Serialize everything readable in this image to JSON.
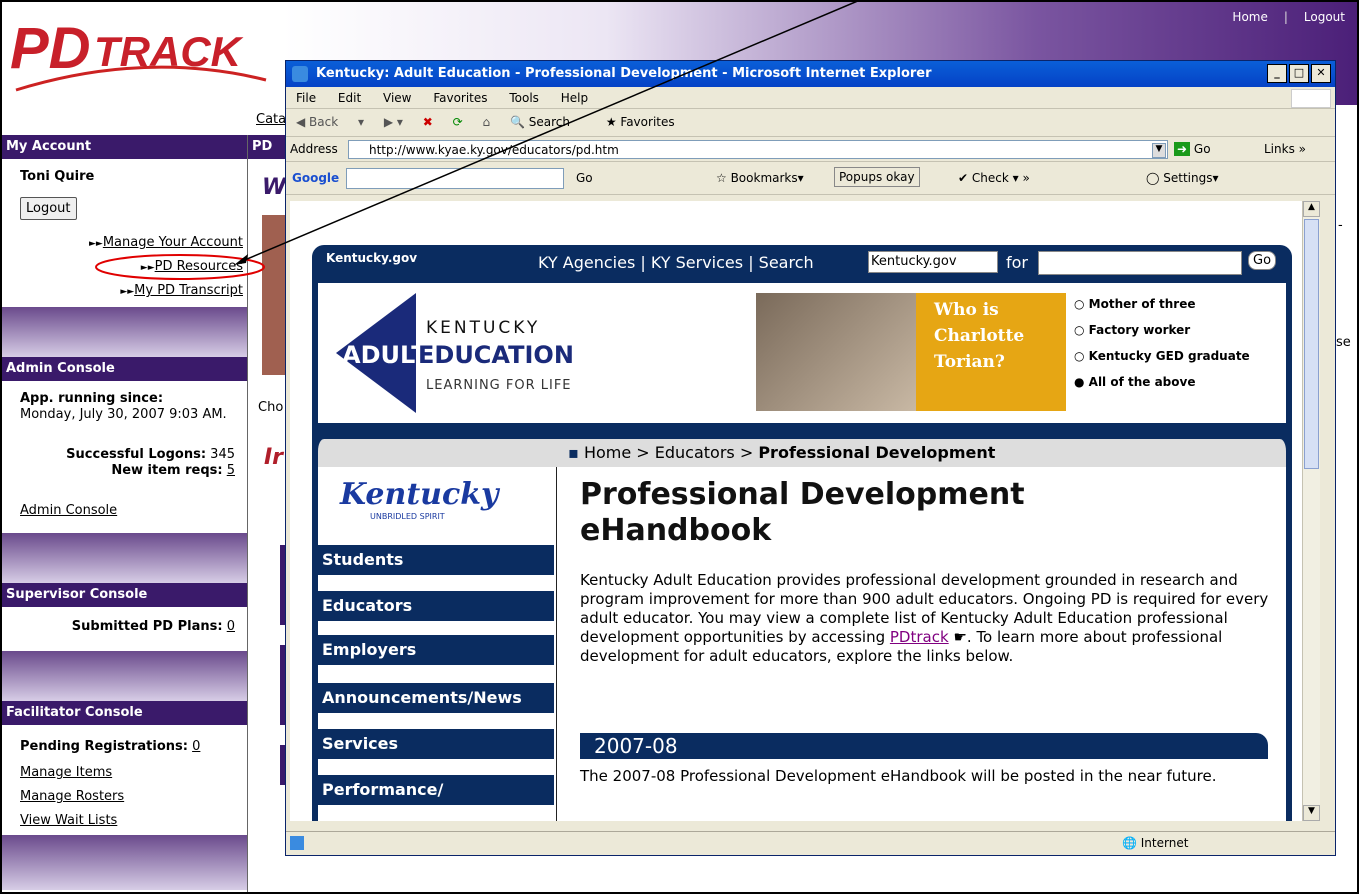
{
  "outer": {
    "toplinks": [
      "Home",
      "Logout"
    ],
    "logo": {
      "pd": "PD",
      "track": "TRACK"
    },
    "cata": "Cata",
    "pd_col": "PD",
    "w": "W",
    "cho": "Cho",
    "ir": "Ir",
    "se": "se",
    "my_account": {
      "title": "My Account",
      "user": "Toni Quire",
      "logout": "Logout",
      "links": [
        "Manage Your Account",
        "PD Resources",
        "My PD Transcript"
      ]
    },
    "admin": {
      "title": "Admin Console",
      "running_label": "App. running since:",
      "running_value": "Monday, July 30, 2007 9:03 AM.",
      "logons_label": "Successful Logons:",
      "logons_value": "345",
      "newreq_label": "New item reqs:",
      "newreq_value": "5",
      "link": "Admin Console"
    },
    "supervisor": {
      "title": "Supervisor Console",
      "plans_label": "Submitted PD Plans:",
      "plans_value": "0"
    },
    "facilitator": {
      "title": "Facilitator Console",
      "pending_label": "Pending Registrations:",
      "pending_value": "0",
      "links": [
        "Manage Items",
        "Manage Rosters",
        "View Wait Lists"
      ]
    }
  },
  "ie": {
    "title": "Kentucky: Adult Education - Professional Development - Microsoft Internet Explorer",
    "menu": [
      "File",
      "Edit",
      "View",
      "Favorites",
      "Tools",
      "Help"
    ],
    "toolbar": [
      "Back",
      "Search",
      "Favorites"
    ],
    "address_label": "Address",
    "url": "http://www.kyae.ky.gov/educators/pd.htm",
    "go": "Go",
    "links": "Links",
    "google": {
      "go": "Go",
      "bookmarks": "Bookmarks",
      "popups": "Popups okay",
      "check": "Check",
      "settings": "Settings"
    },
    "status": "Internet"
  },
  "ky": {
    "brand": "Kentucky.gov",
    "topnav": "KY Agencies | KY Services | Search",
    "search_scope": "Kentucky.gov",
    "for": "for",
    "go": "Go",
    "logo_top": "KENTUCKY",
    "logo_adult": "ADULT",
    "logo_edu": "EDUCATION",
    "logo_tag": "LEARNING FOR LIFE",
    "who": "Who is Charlotte Torian?",
    "options": [
      "Mother of three",
      "Factory worker",
      "Kentucky GED graduate",
      "All of the above"
    ],
    "crumb": {
      "home": "Home",
      "edu": "Educators",
      "current": "Professional Development"
    },
    "ky_script": "Kentucky",
    "ky_tag": "UNBRIDLED SPIRIT",
    "nav": [
      "Students",
      "Educators",
      "Employers",
      "Announcements/News",
      "Services",
      "Performance/"
    ],
    "heading": "Professional Development eHandbook",
    "intro_a": "Kentucky Adult Education provides professional development grounded in research and program improvement for more than 900 adult educators. Ongoing PD is required for every adult educator.  You may view a complete list of Kentucky Adult Education professional development opportunities by accessing ",
    "intro_link": "PDtrack",
    "intro_b": ".  To learn more about professional development for adult educators, explore the links below.",
    "year": "2007-08",
    "year_text": "The 2007-08 Professional Development eHandbook will be posted in the near future."
  }
}
